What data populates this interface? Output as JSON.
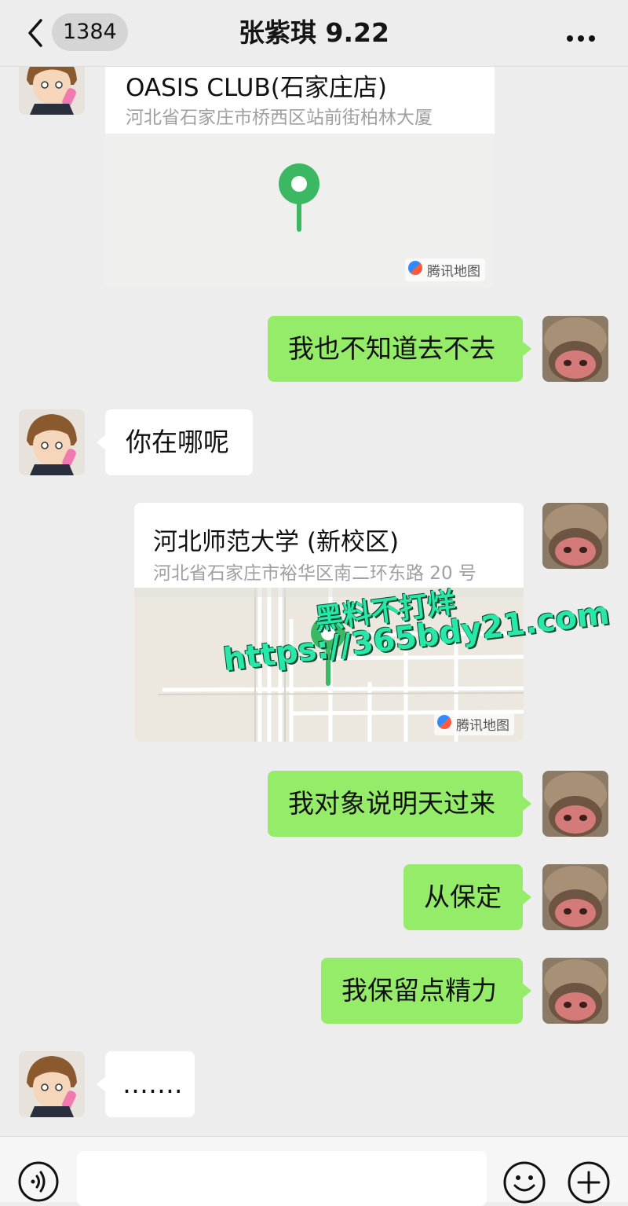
{
  "header": {
    "unread_count": "1384",
    "title": "张紫琪 9.22"
  },
  "messages": {
    "loc1": {
      "title": "OASIS CLUB(石家庄店)",
      "address": "河北省石家庄市桥西区站前街柏林大厦",
      "brand": "腾讯地图"
    },
    "m1": {
      "text": "我也不知道去不去"
    },
    "m2": {
      "text": "你在哪呢"
    },
    "loc2": {
      "title": "河北师范大学 (新校区)",
      "address": "河北省石家庄市裕华区南二环东路 20 号",
      "brand": "腾讯地图"
    },
    "m3": {
      "text": "我对象说明天过来"
    },
    "m4": {
      "text": "从保定"
    },
    "m5": {
      "text": "我保留点精力"
    },
    "m6": {
      "text": "……."
    }
  },
  "watermark": {
    "line1": "黑料不打烊",
    "line2": "https://365bdy21.com"
  },
  "colors": {
    "sent_bubble": "#95ec69",
    "received_bubble": "#ffffff",
    "background": "#ededed",
    "pin": "#3cb863"
  },
  "icons": {
    "back": "chevron-left-icon",
    "more": "ellipsis-icon",
    "voice": "voice-icon",
    "emoji": "emoji-icon",
    "plus": "plus-icon",
    "pin": "map-pin-icon"
  }
}
